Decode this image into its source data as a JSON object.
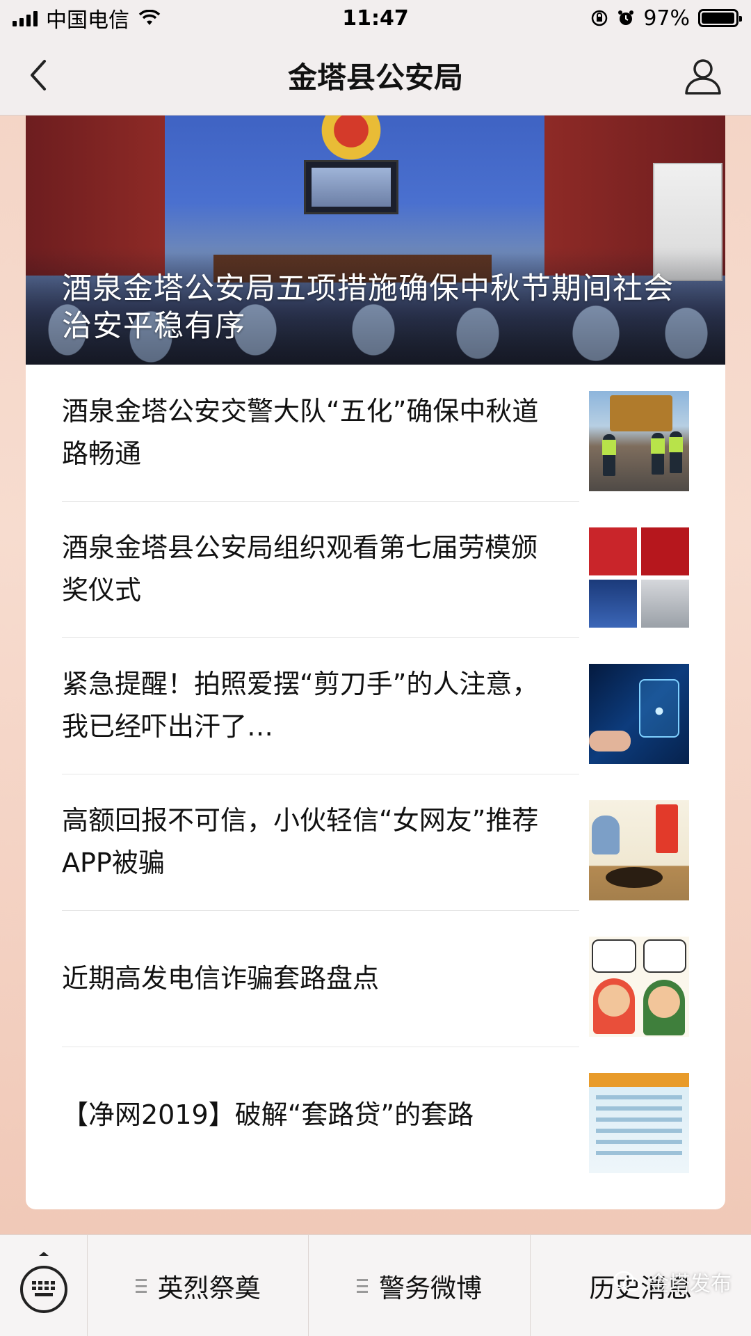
{
  "status_bar": {
    "carrier": "中国电信",
    "time": "11:47",
    "battery_level": "97%",
    "battery_fraction": 0.97,
    "icons": [
      "signal-icon",
      "wifi-icon",
      "rotation-lock-icon",
      "alarm-icon",
      "battery-icon"
    ]
  },
  "nav": {
    "title": "金塔县公安局",
    "back_icon": "chevron-left-icon",
    "profile_icon": "user-icon"
  },
  "hero": {
    "title": "酒泉金塔公安局五项措施确保中秋节期间社会治安平稳有序"
  },
  "articles": [
    {
      "title": "酒泉金塔公安交警大队“五化”确保中秋道路畅通",
      "thumb": "traffic-police-photo"
    },
    {
      "title": "酒泉金塔县公安局组织观看第七届劳模颁奖仪式",
      "thumb": "award-ceremony-collage"
    },
    {
      "title": "紧急提醒！拍照爱摆“剪刀手”的人注意，我已经吓出汗了…",
      "thumb": "fingerprint-scan-image"
    },
    {
      "title": "高额回报不可信，小伙轻信“女网友”推荐APP被骗",
      "thumb": "fraud-cartoon-image"
    },
    {
      "title": "近期高发电信诈骗套路盘点",
      "thumb": "phone-scam-cartoon"
    },
    {
      "title": "【净网2019】破解“套路贷”的套路",
      "thumb": "infographic-image"
    }
  ],
  "menu": {
    "keyboard_icon": "keyboard-icon",
    "items": [
      {
        "label": "英烈祭奠",
        "icon": "menu-list-icon"
      },
      {
        "label": "警务微博",
        "icon": "menu-list-icon"
      },
      {
        "label": "历史消息"
      }
    ]
  },
  "watermark": {
    "label": "金塔发布",
    "icon": "wechat-icon"
  }
}
